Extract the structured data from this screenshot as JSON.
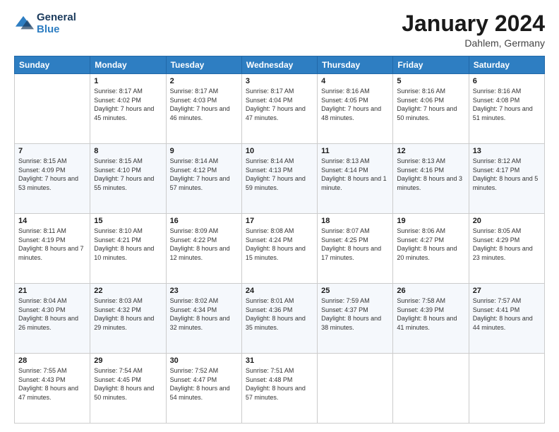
{
  "logo": {
    "line1": "General",
    "line2": "Blue"
  },
  "title": "January 2024",
  "subtitle": "Dahlem, Germany",
  "days_header": [
    "Sunday",
    "Monday",
    "Tuesday",
    "Wednesday",
    "Thursday",
    "Friday",
    "Saturday"
  ],
  "weeks": [
    [
      {
        "day": "",
        "sunrise": "",
        "sunset": "",
        "daylight": ""
      },
      {
        "day": "1",
        "sunrise": "Sunrise: 8:17 AM",
        "sunset": "Sunset: 4:02 PM",
        "daylight": "Daylight: 7 hours and 45 minutes."
      },
      {
        "day": "2",
        "sunrise": "Sunrise: 8:17 AM",
        "sunset": "Sunset: 4:03 PM",
        "daylight": "Daylight: 7 hours and 46 minutes."
      },
      {
        "day": "3",
        "sunrise": "Sunrise: 8:17 AM",
        "sunset": "Sunset: 4:04 PM",
        "daylight": "Daylight: 7 hours and 47 minutes."
      },
      {
        "day": "4",
        "sunrise": "Sunrise: 8:16 AM",
        "sunset": "Sunset: 4:05 PM",
        "daylight": "Daylight: 7 hours and 48 minutes."
      },
      {
        "day": "5",
        "sunrise": "Sunrise: 8:16 AM",
        "sunset": "Sunset: 4:06 PM",
        "daylight": "Daylight: 7 hours and 50 minutes."
      },
      {
        "day": "6",
        "sunrise": "Sunrise: 8:16 AM",
        "sunset": "Sunset: 4:08 PM",
        "daylight": "Daylight: 7 hours and 51 minutes."
      }
    ],
    [
      {
        "day": "7",
        "sunrise": "Sunrise: 8:15 AM",
        "sunset": "Sunset: 4:09 PM",
        "daylight": "Daylight: 7 hours and 53 minutes."
      },
      {
        "day": "8",
        "sunrise": "Sunrise: 8:15 AM",
        "sunset": "Sunset: 4:10 PM",
        "daylight": "Daylight: 7 hours and 55 minutes."
      },
      {
        "day": "9",
        "sunrise": "Sunrise: 8:14 AM",
        "sunset": "Sunset: 4:12 PM",
        "daylight": "Daylight: 7 hours and 57 minutes."
      },
      {
        "day": "10",
        "sunrise": "Sunrise: 8:14 AM",
        "sunset": "Sunset: 4:13 PM",
        "daylight": "Daylight: 7 hours and 59 minutes."
      },
      {
        "day": "11",
        "sunrise": "Sunrise: 8:13 AM",
        "sunset": "Sunset: 4:14 PM",
        "daylight": "Daylight: 8 hours and 1 minute."
      },
      {
        "day": "12",
        "sunrise": "Sunrise: 8:13 AM",
        "sunset": "Sunset: 4:16 PM",
        "daylight": "Daylight: 8 hours and 3 minutes."
      },
      {
        "day": "13",
        "sunrise": "Sunrise: 8:12 AM",
        "sunset": "Sunset: 4:17 PM",
        "daylight": "Daylight: 8 hours and 5 minutes."
      }
    ],
    [
      {
        "day": "14",
        "sunrise": "Sunrise: 8:11 AM",
        "sunset": "Sunset: 4:19 PM",
        "daylight": "Daylight: 8 hours and 7 minutes."
      },
      {
        "day": "15",
        "sunrise": "Sunrise: 8:10 AM",
        "sunset": "Sunset: 4:21 PM",
        "daylight": "Daylight: 8 hours and 10 minutes."
      },
      {
        "day": "16",
        "sunrise": "Sunrise: 8:09 AM",
        "sunset": "Sunset: 4:22 PM",
        "daylight": "Daylight: 8 hours and 12 minutes."
      },
      {
        "day": "17",
        "sunrise": "Sunrise: 8:08 AM",
        "sunset": "Sunset: 4:24 PM",
        "daylight": "Daylight: 8 hours and 15 minutes."
      },
      {
        "day": "18",
        "sunrise": "Sunrise: 8:07 AM",
        "sunset": "Sunset: 4:25 PM",
        "daylight": "Daylight: 8 hours and 17 minutes."
      },
      {
        "day": "19",
        "sunrise": "Sunrise: 8:06 AM",
        "sunset": "Sunset: 4:27 PM",
        "daylight": "Daylight: 8 hours and 20 minutes."
      },
      {
        "day": "20",
        "sunrise": "Sunrise: 8:05 AM",
        "sunset": "Sunset: 4:29 PM",
        "daylight": "Daylight: 8 hours and 23 minutes."
      }
    ],
    [
      {
        "day": "21",
        "sunrise": "Sunrise: 8:04 AM",
        "sunset": "Sunset: 4:30 PM",
        "daylight": "Daylight: 8 hours and 26 minutes."
      },
      {
        "day": "22",
        "sunrise": "Sunrise: 8:03 AM",
        "sunset": "Sunset: 4:32 PM",
        "daylight": "Daylight: 8 hours and 29 minutes."
      },
      {
        "day": "23",
        "sunrise": "Sunrise: 8:02 AM",
        "sunset": "Sunset: 4:34 PM",
        "daylight": "Daylight: 8 hours and 32 minutes."
      },
      {
        "day": "24",
        "sunrise": "Sunrise: 8:01 AM",
        "sunset": "Sunset: 4:36 PM",
        "daylight": "Daylight: 8 hours and 35 minutes."
      },
      {
        "day": "25",
        "sunrise": "Sunrise: 7:59 AM",
        "sunset": "Sunset: 4:37 PM",
        "daylight": "Daylight: 8 hours and 38 minutes."
      },
      {
        "day": "26",
        "sunrise": "Sunrise: 7:58 AM",
        "sunset": "Sunset: 4:39 PM",
        "daylight": "Daylight: 8 hours and 41 minutes."
      },
      {
        "day": "27",
        "sunrise": "Sunrise: 7:57 AM",
        "sunset": "Sunset: 4:41 PM",
        "daylight": "Daylight: 8 hours and 44 minutes."
      }
    ],
    [
      {
        "day": "28",
        "sunrise": "Sunrise: 7:55 AM",
        "sunset": "Sunset: 4:43 PM",
        "daylight": "Daylight: 8 hours and 47 minutes."
      },
      {
        "day": "29",
        "sunrise": "Sunrise: 7:54 AM",
        "sunset": "Sunset: 4:45 PM",
        "daylight": "Daylight: 8 hours and 50 minutes."
      },
      {
        "day": "30",
        "sunrise": "Sunrise: 7:52 AM",
        "sunset": "Sunset: 4:47 PM",
        "daylight": "Daylight: 8 hours and 54 minutes."
      },
      {
        "day": "31",
        "sunrise": "Sunrise: 7:51 AM",
        "sunset": "Sunset: 4:48 PM",
        "daylight": "Daylight: 8 hours and 57 minutes."
      },
      {
        "day": "",
        "sunrise": "",
        "sunset": "",
        "daylight": ""
      },
      {
        "day": "",
        "sunrise": "",
        "sunset": "",
        "daylight": ""
      },
      {
        "day": "",
        "sunrise": "",
        "sunset": "",
        "daylight": ""
      }
    ]
  ]
}
